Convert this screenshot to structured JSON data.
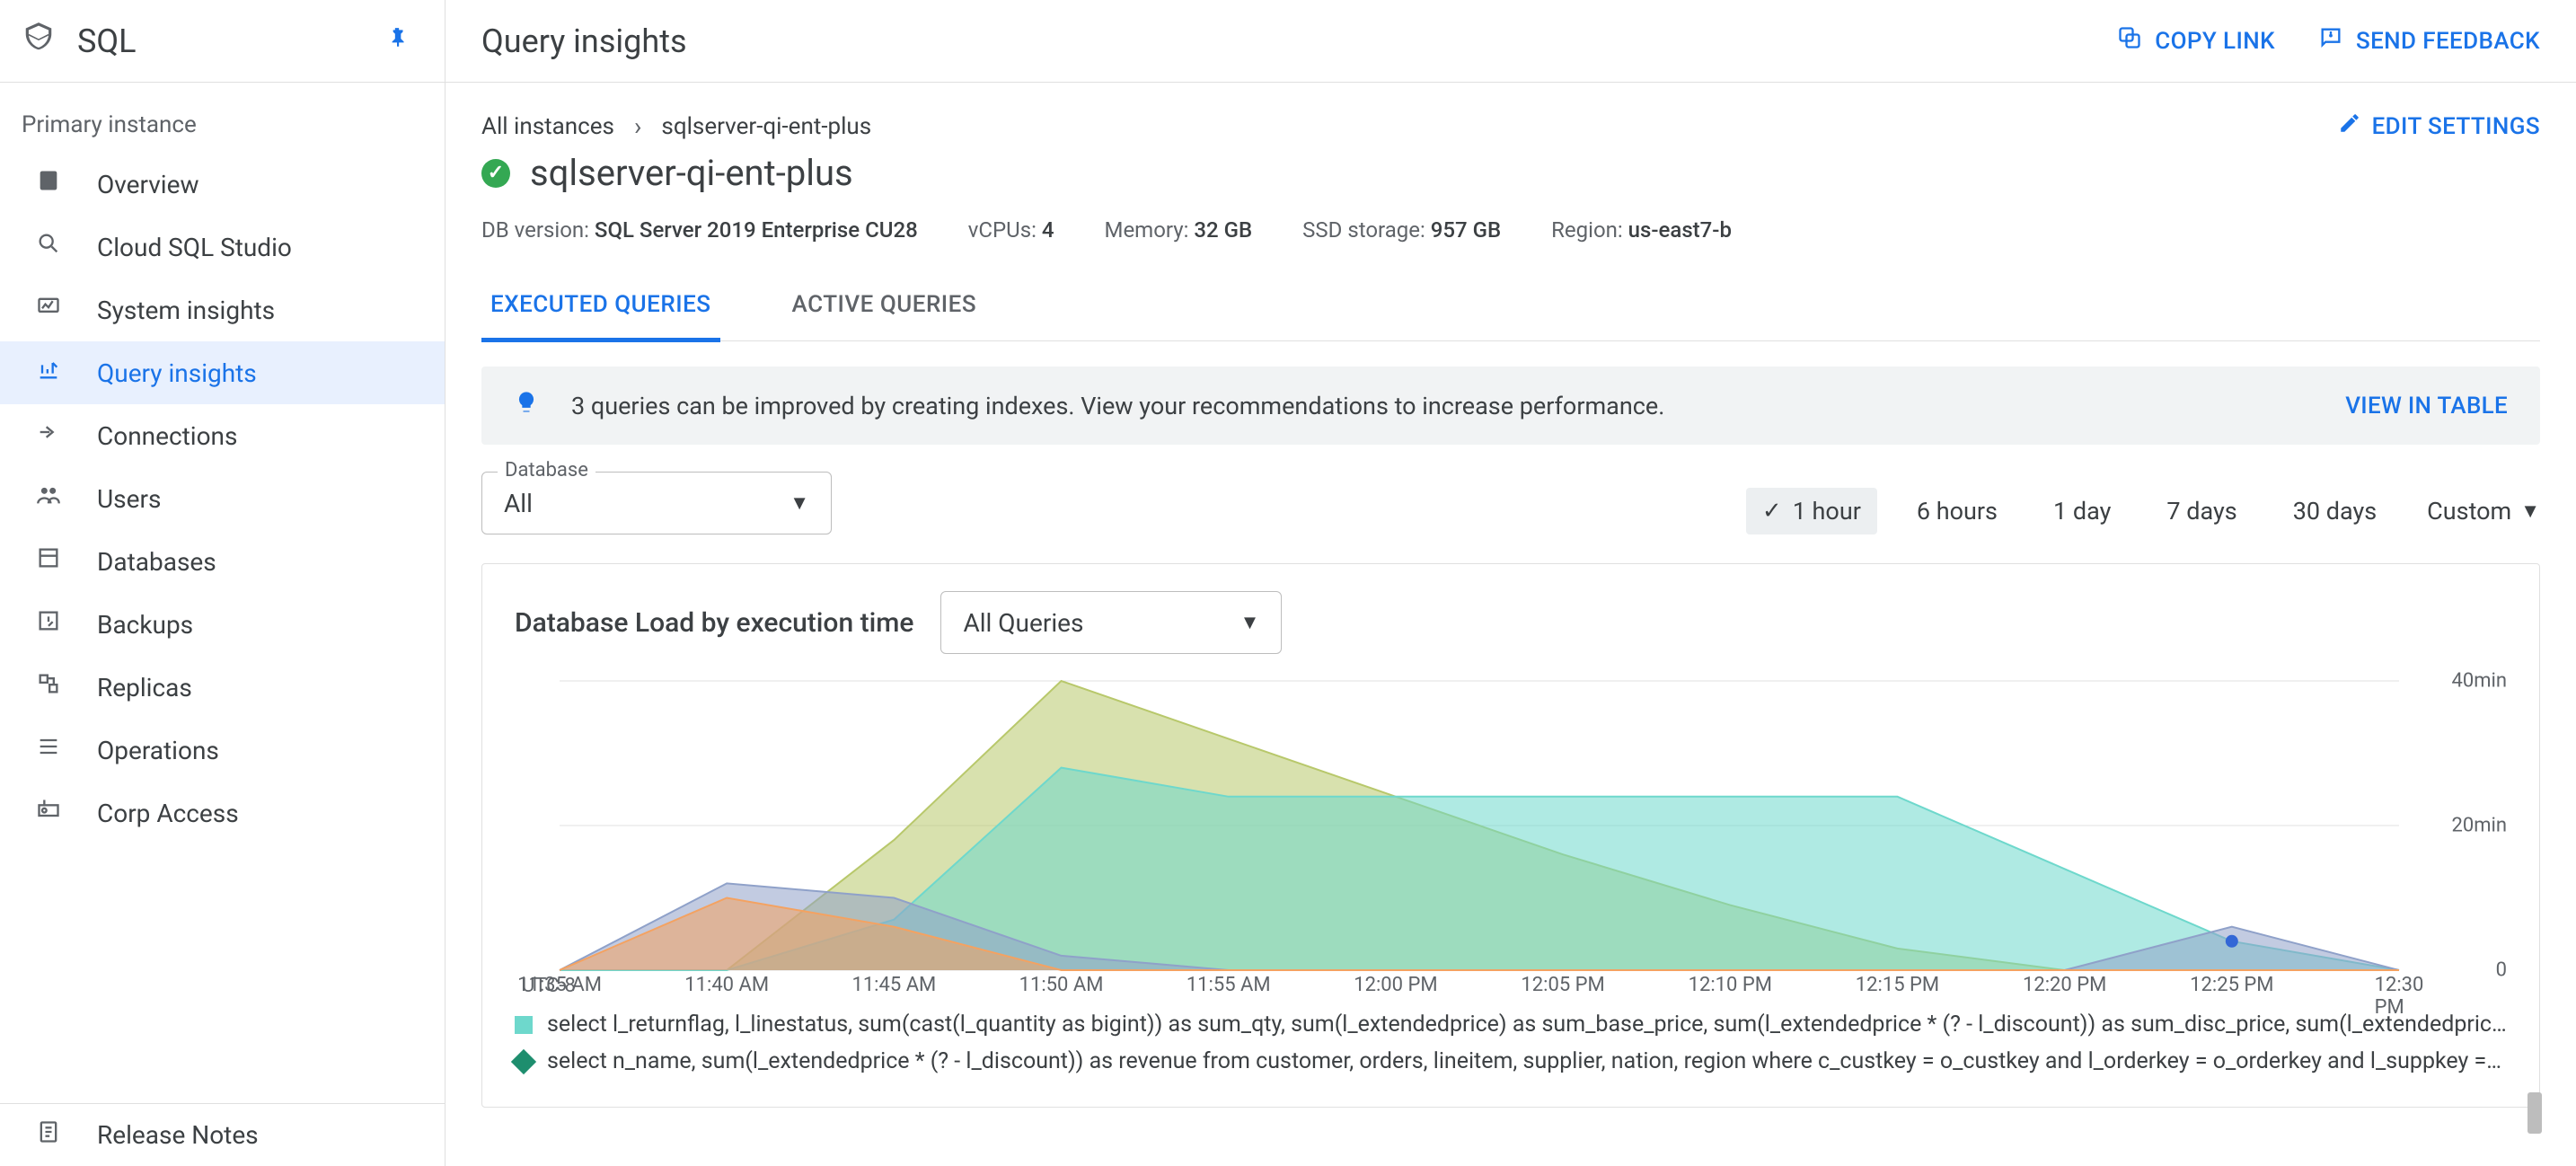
{
  "brand": {
    "product": "SQL"
  },
  "header": {
    "page_title": "Query insights",
    "actions": {
      "copy_link": "COPY LINK",
      "send_feedback": "SEND FEEDBACK"
    }
  },
  "sidebar": {
    "section": "Primary instance",
    "items": [
      {
        "label": "Overview"
      },
      {
        "label": "Cloud SQL Studio"
      },
      {
        "label": "System insights"
      },
      {
        "label": "Query insights"
      },
      {
        "label": "Connections"
      },
      {
        "label": "Users"
      },
      {
        "label": "Databases"
      },
      {
        "label": "Backups"
      },
      {
        "label": "Replicas"
      },
      {
        "label": "Operations"
      },
      {
        "label": "Corp Access"
      }
    ],
    "release_notes": "Release Notes"
  },
  "breadcrumb": {
    "root": "All instances",
    "current": "sqlserver-qi-ent-plus",
    "edit": "EDIT SETTINGS"
  },
  "instance": {
    "name": "sqlserver-qi-ent-plus",
    "meta": {
      "db_version_label": "DB version: ",
      "db_version": "SQL Server 2019 Enterprise CU28",
      "vcpus_label": "vCPUs: ",
      "vcpus": "4",
      "memory_label": "Memory: ",
      "memory": "32 GB",
      "storage_label": "SSD storage: ",
      "storage": "957 GB",
      "region_label": "Region: ",
      "region": "us-east7-b"
    }
  },
  "tabs": {
    "executed": "EXECUTED QUERIES",
    "active": "ACTIVE QUERIES"
  },
  "banner": {
    "text": "3 queries can be improved by creating indexes. View your recommendations to increase performance.",
    "link": "VIEW IN TABLE"
  },
  "filters": {
    "database_label": "Database",
    "database_value": "All"
  },
  "time_ranges": {
    "hour1": "1 hour",
    "hours6": "6 hours",
    "day1": "1 day",
    "days7": "7 days",
    "days30": "30 days",
    "custom": "Custom"
  },
  "chart": {
    "title": "Database Load by execution time",
    "filter": "All Queries",
    "tz": "UTC-8",
    "legend": [
      {
        "color": "#6ed8cc",
        "shape": "square",
        "text": "select l_returnflag, l_linestatus, sum(cast(l_quantity as bigint)) as sum_qty, sum(l_extendedprice) as sum_base_price, sum(l_extendedprice * (? - l_discount)) as sum_disc_price, sum(l_extendedprice * (? - l_discount) * (? + l_tax)) …"
      },
      {
        "color": "#1e8e6e",
        "shape": "diamond",
        "text": "select n_name, sum(l_extendedprice * (? - l_discount)) as revenue from customer, orders, lineitem, supplier, nation, region where c_custkey = o_custkey and l_orderkey = o_orderkey and l_suppkey = s_suppkey and c_nationkey = s…"
      }
    ]
  },
  "chart_data": {
    "type": "area",
    "title": "Database Load by execution time",
    "ylabel": "minutes",
    "ylim": [
      0,
      40
    ],
    "y_ticks": [
      0,
      20,
      40
    ],
    "y_tick_labels": [
      "0",
      "20min",
      "40min"
    ],
    "x_categories": [
      "11:35 AM",
      "11:40 AM",
      "11:45 AM",
      "11:50 AM",
      "11:55 AM",
      "12:00 PM",
      "12:05 PM",
      "12:10 PM",
      "12:15 PM",
      "12:20 PM",
      "12:25 PM",
      "12:30 PM"
    ],
    "tz": "UTC-8",
    "series": [
      {
        "name": "teal",
        "color": "#6ed8cc",
        "values": [
          0,
          0,
          7,
          28,
          24,
          24,
          24,
          24,
          24,
          14,
          4,
          0
        ]
      },
      {
        "name": "green",
        "color": "#b8c86b",
        "values": [
          0,
          0,
          18,
          40,
          32,
          24,
          16,
          9,
          3,
          0,
          0,
          0
        ]
      },
      {
        "name": "blue",
        "color": "#8fa1c9",
        "values": [
          0,
          12,
          10,
          2,
          0,
          0,
          0,
          0,
          0,
          0,
          6,
          0
        ]
      },
      {
        "name": "orange",
        "color": "#f4a261",
        "values": [
          0,
          10,
          6,
          0,
          0,
          0,
          0,
          0,
          0,
          0,
          0,
          0
        ]
      }
    ],
    "marker": {
      "x_index": 10,
      "y": 4,
      "color": "#3367d6"
    }
  }
}
